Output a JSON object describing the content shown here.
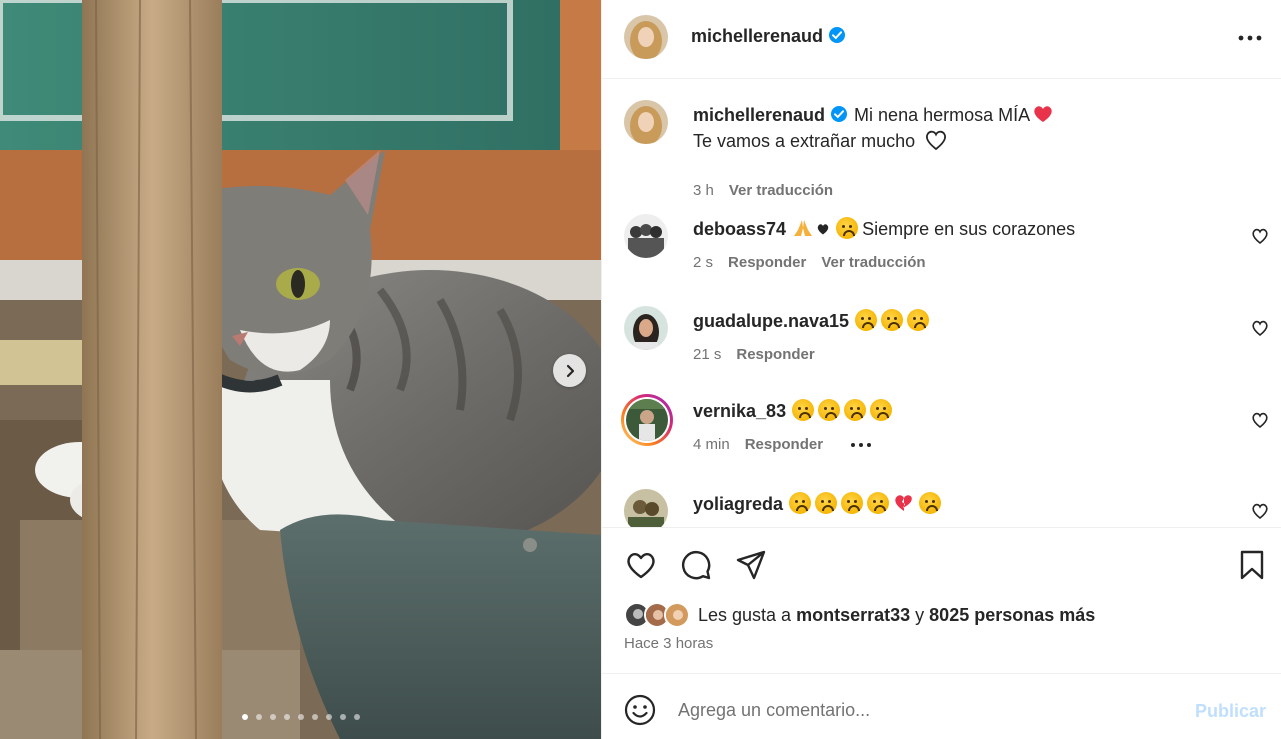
{
  "post": {
    "author": "michellerenaud",
    "caption_line1": "Mi nena hermosa MÍA",
    "caption_line2": "Te vamos a extrañar mucho",
    "caption_time": "3 h",
    "translate_label": "Ver traducción"
  },
  "carousel": {
    "total": 9,
    "active": 0
  },
  "comments": [
    {
      "user": "deboass74",
      "text": "Siempre en sus corazones",
      "time": "2 s",
      "reply": "Responder",
      "translate": "Ver traducción"
    },
    {
      "user": "guadalupe.nava15",
      "text": "",
      "time": "21 s",
      "reply": "Responder"
    },
    {
      "user": "vernika_83",
      "text": "",
      "time": "4 min",
      "reply": "Responder"
    },
    {
      "user": "yoliagreda",
      "text": "",
      "time": "",
      "reply": ""
    }
  ],
  "likes": {
    "prefix": "Les gusta a",
    "user": "montserrat33",
    "connector": "y",
    "count_text": "8025 personas más"
  },
  "timestamp": "Hace 3 horas",
  "composer": {
    "placeholder": "Agrega un comentario...",
    "publish_label": "Publicar"
  },
  "colors": {
    "verified": "#0095f6",
    "text_primary": "#262626",
    "text_secondary": "#737373",
    "publish_disabled": "#c0dffd",
    "story_ring_start": "#feda75",
    "story_ring_end": "#d62976"
  },
  "icons": [
    "verified-badge-icon",
    "more-options-icon",
    "heart-icon",
    "comment-icon",
    "share-icon",
    "bookmark-icon",
    "emoji-icon",
    "chevron-right-icon"
  ]
}
